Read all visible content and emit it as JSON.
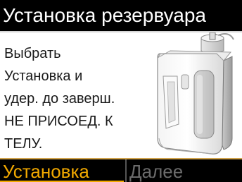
{
  "header": {
    "title": "Установка резервуара"
  },
  "instructions": [
    "Выбрать",
    "Установка и",
    "удер. до заверш.",
    "НЕ ПРИСОЕД. К",
    "ТЕЛУ."
  ],
  "illustration": {
    "icon": "pump-reservoir-device-icon"
  },
  "softkeys": {
    "left_label": "Установка",
    "right_label": "Далее",
    "left_color": "#f2a900",
    "right_color": "#6b6b6b"
  }
}
